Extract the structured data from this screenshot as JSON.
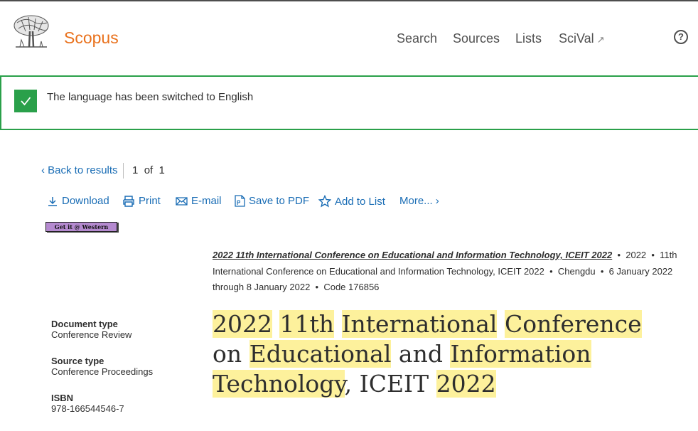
{
  "header": {
    "brand": "Scopus",
    "nav": [
      {
        "label": "Search"
      },
      {
        "label": "Sources"
      },
      {
        "label": "Lists"
      },
      {
        "label": "SciVal",
        "external_marker": "↗"
      }
    ],
    "help_symbol": "?"
  },
  "notification": {
    "message": "The language has been switched to English",
    "color": "#2aa04a"
  },
  "results_nav": {
    "back_label": "Back to results",
    "current": "1",
    "of_label": "of",
    "total": "1"
  },
  "toolbar": {
    "download": "Download",
    "print": "Print",
    "email": "E-mail",
    "save_pdf": "Save to PDF",
    "add_list": "Add to List",
    "more": "More..."
  },
  "getit_button": "Get it @ Western",
  "source": {
    "conference_link": "2022 11th International Conference on Educational and Information Technology, ICEIT 2022",
    "year": "2022",
    "conference_name": "11th International Conference on Educational and Information Technology, ICEIT 2022",
    "location": "Chengdu",
    "dates": "6 January 2022 through 8 January 2022",
    "code": "Code 176856"
  },
  "details": {
    "document_type_label": "Document type",
    "document_type": "Conference Review",
    "source_type_label": "Source type",
    "source_type": "Conference Proceedings",
    "isbn_label": "ISBN",
    "isbn": "978-166544546-7"
  },
  "title": {
    "w1": "2022",
    "w2": "11th",
    "w3": "International",
    "w4": "Conference",
    "w5": "on",
    "w6": "Educational",
    "w7": "and",
    "w8": "Information",
    "w9": "Technology",
    "w10": ",",
    "w11": "ICEIT",
    "w12": "2022"
  },
  "colors": {
    "brand": "#e9711c",
    "link": "#1a6db5",
    "highlight": "#fdf19c",
    "success": "#2aa04a"
  }
}
